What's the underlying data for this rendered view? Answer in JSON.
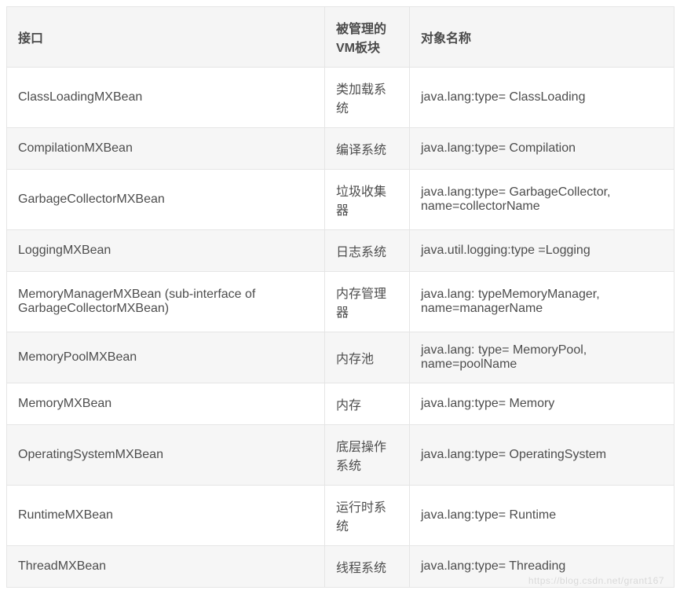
{
  "table": {
    "headers": [
      "接口",
      "被管理的VM板块",
      "对象名称"
    ],
    "rows": [
      {
        "interface": "ClassLoadingMXBean",
        "vm_module": "类加载系统",
        "object_name": "java.lang:type= ClassLoading"
      },
      {
        "interface": "CompilationMXBean",
        "vm_module": "编译系统",
        "object_name": "java.lang:type= Compilation"
      },
      {
        "interface": "GarbageCollectorMXBean",
        "vm_module": "垃圾收集器",
        "object_name": "java.lang:type= GarbageCollector, name=collectorName"
      },
      {
        "interface": "LoggingMXBean",
        "vm_module": "日志系统",
        "object_name": "java.util.logging:type =Logging"
      },
      {
        "interface": "MemoryManagerMXBean (sub-interface of GarbageCollectorMXBean)",
        "vm_module": "内存管理器",
        "object_name": "java.lang: typeMemoryManager, name=managerName"
      },
      {
        "interface": "MemoryPoolMXBean",
        "vm_module": "内存池",
        "object_name": "java.lang: type= MemoryPool, name=poolName"
      },
      {
        "interface": "MemoryMXBean",
        "vm_module": "内存",
        "object_name": "java.lang:type= Memory"
      },
      {
        "interface": "OperatingSystemMXBean",
        "vm_module": "底层操作系统",
        "object_name": "java.lang:type= OperatingSystem"
      },
      {
        "interface": "RuntimeMXBean",
        "vm_module": "运行时系统",
        "object_name": "java.lang:type= Runtime"
      },
      {
        "interface": "ThreadMXBean",
        "vm_module": "线程系统",
        "object_name": "java.lang:type= Threading"
      }
    ]
  },
  "watermark": "https://blog.csdn.net/grant167"
}
